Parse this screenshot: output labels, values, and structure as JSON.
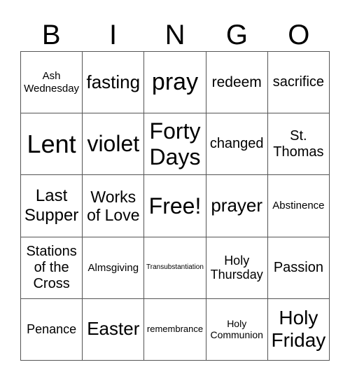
{
  "header": [
    "B",
    "I",
    "N",
    "G",
    "O"
  ],
  "cells": [
    {
      "text": "Ash Wednesday",
      "size": 15
    },
    {
      "text": "fasting",
      "size": 26
    },
    {
      "text": "pray",
      "size": 34
    },
    {
      "text": "redeem",
      "size": 21
    },
    {
      "text": "sacrifice",
      "size": 20
    },
    {
      "text": "Lent",
      "size": 36
    },
    {
      "text": "violet",
      "size": 32
    },
    {
      "text": "Forty Days",
      "size": 32
    },
    {
      "text": "changed",
      "size": 20
    },
    {
      "text": "St. Thomas",
      "size": 20
    },
    {
      "text": "Last Supper",
      "size": 24
    },
    {
      "text": "Works of Love",
      "size": 23
    },
    {
      "text": "Free!",
      "size": 32
    },
    {
      "text": "prayer",
      "size": 26
    },
    {
      "text": "Abstinence",
      "size": 15
    },
    {
      "text": "Stations of the Cross",
      "size": 20
    },
    {
      "text": "Almsgiving",
      "size": 15
    },
    {
      "text": "Transubstantiation",
      "size": 10
    },
    {
      "text": "Holy Thursday",
      "size": 18
    },
    {
      "text": "Passion",
      "size": 20
    },
    {
      "text": "Penance",
      "size": 18
    },
    {
      "text": "Easter",
      "size": 26
    },
    {
      "text": "remembrance",
      "size": 13
    },
    {
      "text": "Holy Communion",
      "size": 14
    },
    {
      "text": "Holy Friday",
      "size": 28
    }
  ]
}
